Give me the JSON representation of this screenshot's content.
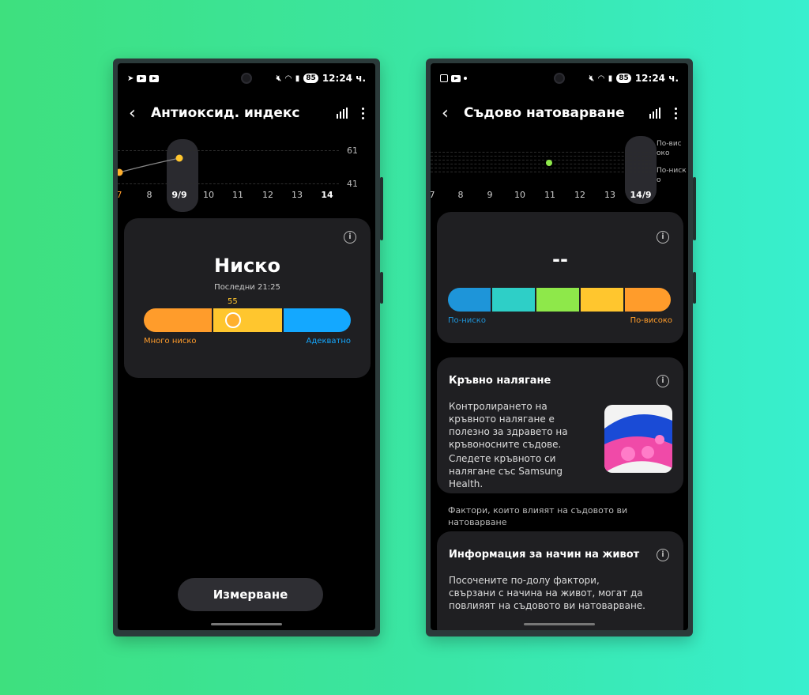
{
  "colors": {
    "accent_orange": "#ff9c2b",
    "accent_yellow": "#ffc62e",
    "accent_blue": "#14a8ff",
    "point_green": "#8ee84a"
  },
  "left_phone": {
    "status": {
      "time": "12:24 ч.",
      "battery": "85",
      "icons": [
        "telegram-icon",
        "youtube-icon",
        "youtube-icon",
        "mute-icon",
        "wifi-icon",
        "signal-icon"
      ]
    },
    "title": "Антиоксид. индекс",
    "chart": {
      "y_ticks": [
        "61",
        "41"
      ],
      "dates": [
        "7",
        "8",
        "9/9",
        "10",
        "11",
        "12",
        "13",
        "14"
      ],
      "selected": "9/9"
    },
    "card": {
      "result": "Ниско",
      "last": "Последни 21:25",
      "marker_value": "55",
      "marker_fraction": 0.43,
      "scale_low": "Много ниско",
      "scale_high": "Адекватно"
    },
    "measure_button": "Измерване"
  },
  "right_phone": {
    "status": {
      "time": "12:24 ч.",
      "battery": "85",
      "icons": [
        "screenshot-icon",
        "youtube-icon",
        "dot-icon",
        "mute-icon",
        "wifi-icon",
        "signal-icon"
      ]
    },
    "title": "Съдово натоварване",
    "chart": {
      "y_labels": [
        "По-вис",
        "око",
        "По-ниск",
        "о"
      ],
      "dates": [
        "7",
        "8",
        "9",
        "10",
        "11",
        "12",
        "13",
        "14/9"
      ],
      "selected": "14/9"
    },
    "card": {
      "value": "--",
      "scale_low": "По-ниско",
      "scale_high": "По-високо"
    },
    "bp_card": {
      "title": "Кръвно налягане",
      "text1": "Контролирането на кръвното налягане е полезно за здравето на кръвоносните съдове.",
      "text2": "Следете кръвното си налягане със Samsung Health."
    },
    "factors_heading": "Фактори, които влияят на съдовото ви натоварване",
    "lifestyle_card": {
      "title": "Информация за начин на живот",
      "text": "Посочените по-долу фактори, свързани с начина на живот, могат да повлияят на съдовото ви натоварване. Можете да"
    }
  }
}
